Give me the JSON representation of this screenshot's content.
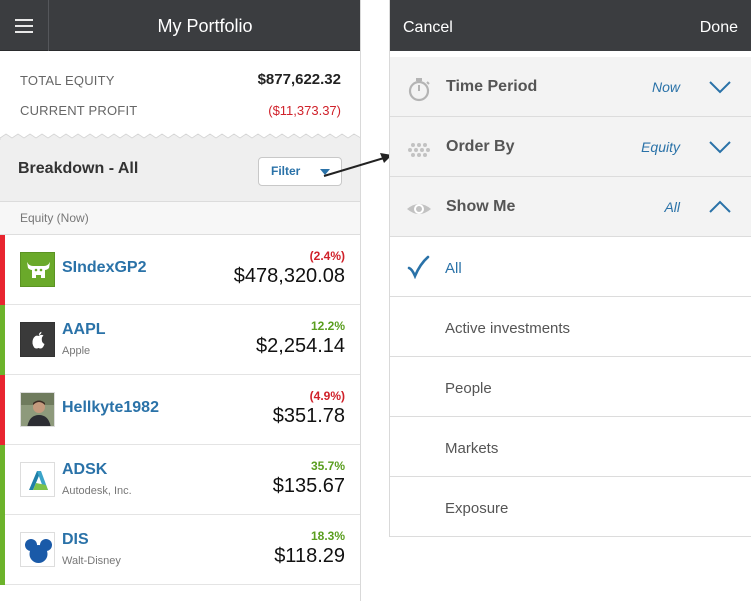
{
  "portfolio": {
    "title": "My Portfolio",
    "total_equity_label": "TOTAL EQUITY",
    "total_equity_value": "$877,622.32",
    "current_profit_label": "CURRENT PROFIT",
    "current_profit_value": "($11,373.37)",
    "breakdown_title": "Breakdown - All",
    "filter_label": "Filter",
    "column_header": "Equity (Now)",
    "rows": [
      {
        "name": "SIndexGP2",
        "sub": "",
        "pct": "(2.4%)",
        "amount": "$478,320.08",
        "trend": "negative"
      },
      {
        "name": "AAPL",
        "sub": "Apple",
        "pct": "12.2%",
        "amount": "$2,254.14",
        "trend": "positive"
      },
      {
        "name": "Hellkyte1982",
        "sub": "",
        "pct": "(4.9%)",
        "amount": "$351.78",
        "trend": "negative"
      },
      {
        "name": "ADSK",
        "sub": "Autodesk, Inc.",
        "pct": "35.7%",
        "amount": "$135.67",
        "trend": "positive"
      },
      {
        "name": "DIS",
        "sub": "Walt-Disney",
        "pct": "18.3%",
        "amount": "$118.29",
        "trend": "positive"
      }
    ]
  },
  "filter_panel": {
    "cancel_label": "Cancel",
    "done_label": "Done",
    "options": [
      {
        "label": "Time Period",
        "value": "Now",
        "icon": "stopwatch-icon",
        "expanded": false
      },
      {
        "label": "Order By",
        "value": "Equity",
        "icon": "dots-icon",
        "expanded": false
      },
      {
        "label": "Show Me",
        "value": "All",
        "icon": "eye-icon",
        "expanded": true
      }
    ],
    "choices": [
      {
        "label": "All",
        "selected": true
      },
      {
        "label": "Active investments",
        "selected": false
      },
      {
        "label": "People",
        "selected": false
      },
      {
        "label": "Markets",
        "selected": false
      },
      {
        "label": "Exposure",
        "selected": false
      }
    ]
  },
  "colors": {
    "header_bg": "#3b3d40",
    "accent_blue": "#2a72a8",
    "positive_green": "#5a9e1f",
    "negative_red": "#d0212a"
  }
}
